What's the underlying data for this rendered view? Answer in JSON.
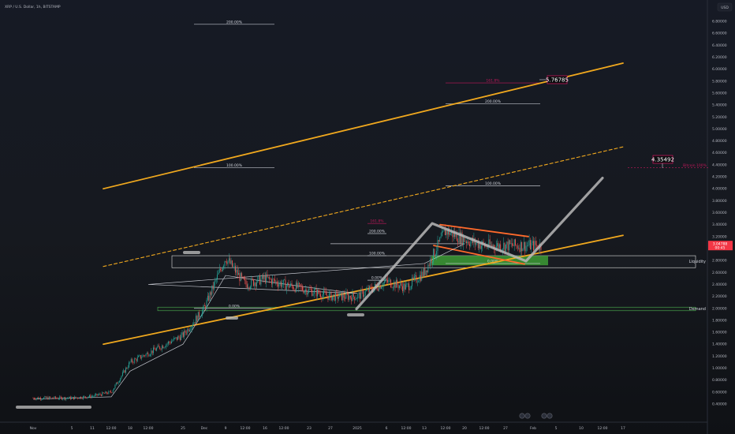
{
  "header": {
    "symbol": "XRP / U.S. Dollar, 1h, BITSTAMP",
    "currency": "USD"
  },
  "colors": {
    "background": "#131722",
    "candle_up": "#26a69a",
    "candle_down": "#ef5350",
    "channel": "#f0a81e",
    "flag": "#ff6a2b",
    "path": "#b8b8b8",
    "fib": "#d1d4dc",
    "target_red": "#c2185b",
    "demand": "#4caf50",
    "liquidity_fill": "#3d9b35",
    "price_badge": "#f23645"
  },
  "chart_data": {
    "type": "candlestick",
    "title": "",
    "xlabel": "",
    "ylabel": "",
    "x_ticks": [
      "Nov",
      "5",
      "11",
      "12:00",
      "18",
      "12:00",
      "25",
      "Dec",
      "9",
      "12:00",
      "16",
      "12:00",
      "23",
      "27",
      "2025",
      "6",
      "12:00",
      "13",
      "12:00",
      "20",
      "12:00",
      "27",
      "Feb",
      "5",
      "10",
      "12:00",
      "17"
    ],
    "y_ticks": [
      "0.40000",
      "0.60000",
      "0.80000",
      "1.00000",
      "1.20000",
      "1.40000",
      "1.60000",
      "1.80000",
      "2.00000",
      "2.20000",
      "2.40000",
      "2.60000",
      "2.80000",
      "3.00000",
      "3.20000",
      "3.40000",
      "3.60000",
      "3.80000",
      "4.00000",
      "4.20000",
      "4.40000",
      "4.60000",
      "4.80000",
      "5.00000",
      "5.20000",
      "5.40000",
      "5.60000",
      "5.80000",
      "6.00000",
      "6.20000",
      "6.40000",
      "6.60000",
      "6.80000"
    ],
    "ylim": [
      0.28,
      7.0
    ],
    "log_scale": false,
    "grid": false,
    "current_price": {
      "label": "3.04788",
      "sub": "00:45",
      "value": 3.05
    },
    "price_path": [
      [
        "Nov",
        0.5
      ],
      [
        "5",
        0.5
      ],
      [
        "11",
        0.53
      ],
      [
        "12:00",
        0.6
      ],
      [
        "18",
        1.1
      ],
      [
        "12:00",
        1.25
      ],
      [
        "25",
        1.55
      ],
      [
        "Dec",
        2.0
      ],
      [
        "9",
        2.85
      ],
      [
        "12:00",
        2.4
      ],
      [
        "16",
        2.5
      ],
      [
        "12:00",
        2.4
      ],
      [
        "23",
        2.3
      ],
      [
        "27",
        2.2
      ],
      [
        "2025",
        2.2
      ],
      [
        "6",
        2.45
      ],
      [
        "12:00",
        2.35
      ],
      [
        "13",
        2.6
      ],
      [
        "12:00",
        3.3
      ],
      [
        "20",
        3.15
      ],
      [
        "12:00",
        3.05
      ],
      [
        "27",
        3.05
      ]
    ],
    "moving_average": [
      [
        "Nov",
        0.48
      ],
      [
        "12:00",
        0.52
      ],
      [
        "18",
        0.95
      ],
      [
        "25",
        1.4
      ],
      [
        "Dec",
        1.95
      ],
      [
        "9",
        2.55
      ],
      [
        "16",
        2.45
      ],
      [
        "23",
        2.35
      ],
      [
        "2025",
        2.25
      ],
      [
        "12:00",
        2.4
      ],
      [
        "13",
        2.75
      ],
      [
        "20",
        3.08
      ],
      [
        "27",
        3.08
      ]
    ],
    "ascending_channel": {
      "lower": [
        [
          "18",
          1.4
        ],
        [
          "17",
          3.22
        ]
      ],
      "mid": [
        [
          "Nov",
          2.7
        ],
        [
          "17",
          4.7
        ]
      ],
      "upper": [
        [
          "18",
          4.0
        ],
        [
          "17",
          6.1
        ]
      ]
    },
    "bull_flag": {
      "upper": [
        [
          "13",
          3.4
        ],
        [
          "Feb",
          3.2
        ]
      ],
      "lower": [
        [
          "13",
          3.05
        ],
        [
          "Feb",
          2.72
        ]
      ]
    },
    "projected_path": [
      [
        "2025",
        2.0
      ],
      [
        "13",
        3.4
      ],
      [
        "Feb",
        2.8
      ],
      [
        "10",
        4.2
      ]
    ],
    "zones": [
      {
        "name": "Liquidity",
        "from": 2.68,
        "to": 2.88
      },
      {
        "name": "Demand",
        "from": 1.96,
        "to": 2.02
      }
    ],
    "fib_levels": [
      {
        "label": "200.00%",
        "value": 6.75
      },
      {
        "label": "100.00%",
        "value": 4.35
      },
      {
        "label": "0.00%",
        "value": 2.0
      },
      {
        "label": "200.00%",
        "value": 3.25
      },
      {
        "label": "100.00%",
        "value": 2.88
      },
      {
        "label": "0.00%",
        "value": 2.47
      },
      {
        "label": "200.00%",
        "value": 5.42
      },
      {
        "label": "100.00%",
        "value": 4.05
      },
      {
        "label": "0.00%",
        "value": 2.75
      }
    ],
    "red_levels": [
      {
        "label": "161.8%",
        "value": 3.42
      },
      {
        "label": "161.8%",
        "value": 5.77
      },
      {
        "label": "Bitcoin 100%",
        "value": 4.35
      }
    ],
    "callouts": [
      {
        "label": "5.76785",
        "value": 5.77
      },
      {
        "label": "4.35492",
        "value": 4.35
      }
    ],
    "annotations": [
      "Liquidity",
      "Demand"
    ]
  }
}
